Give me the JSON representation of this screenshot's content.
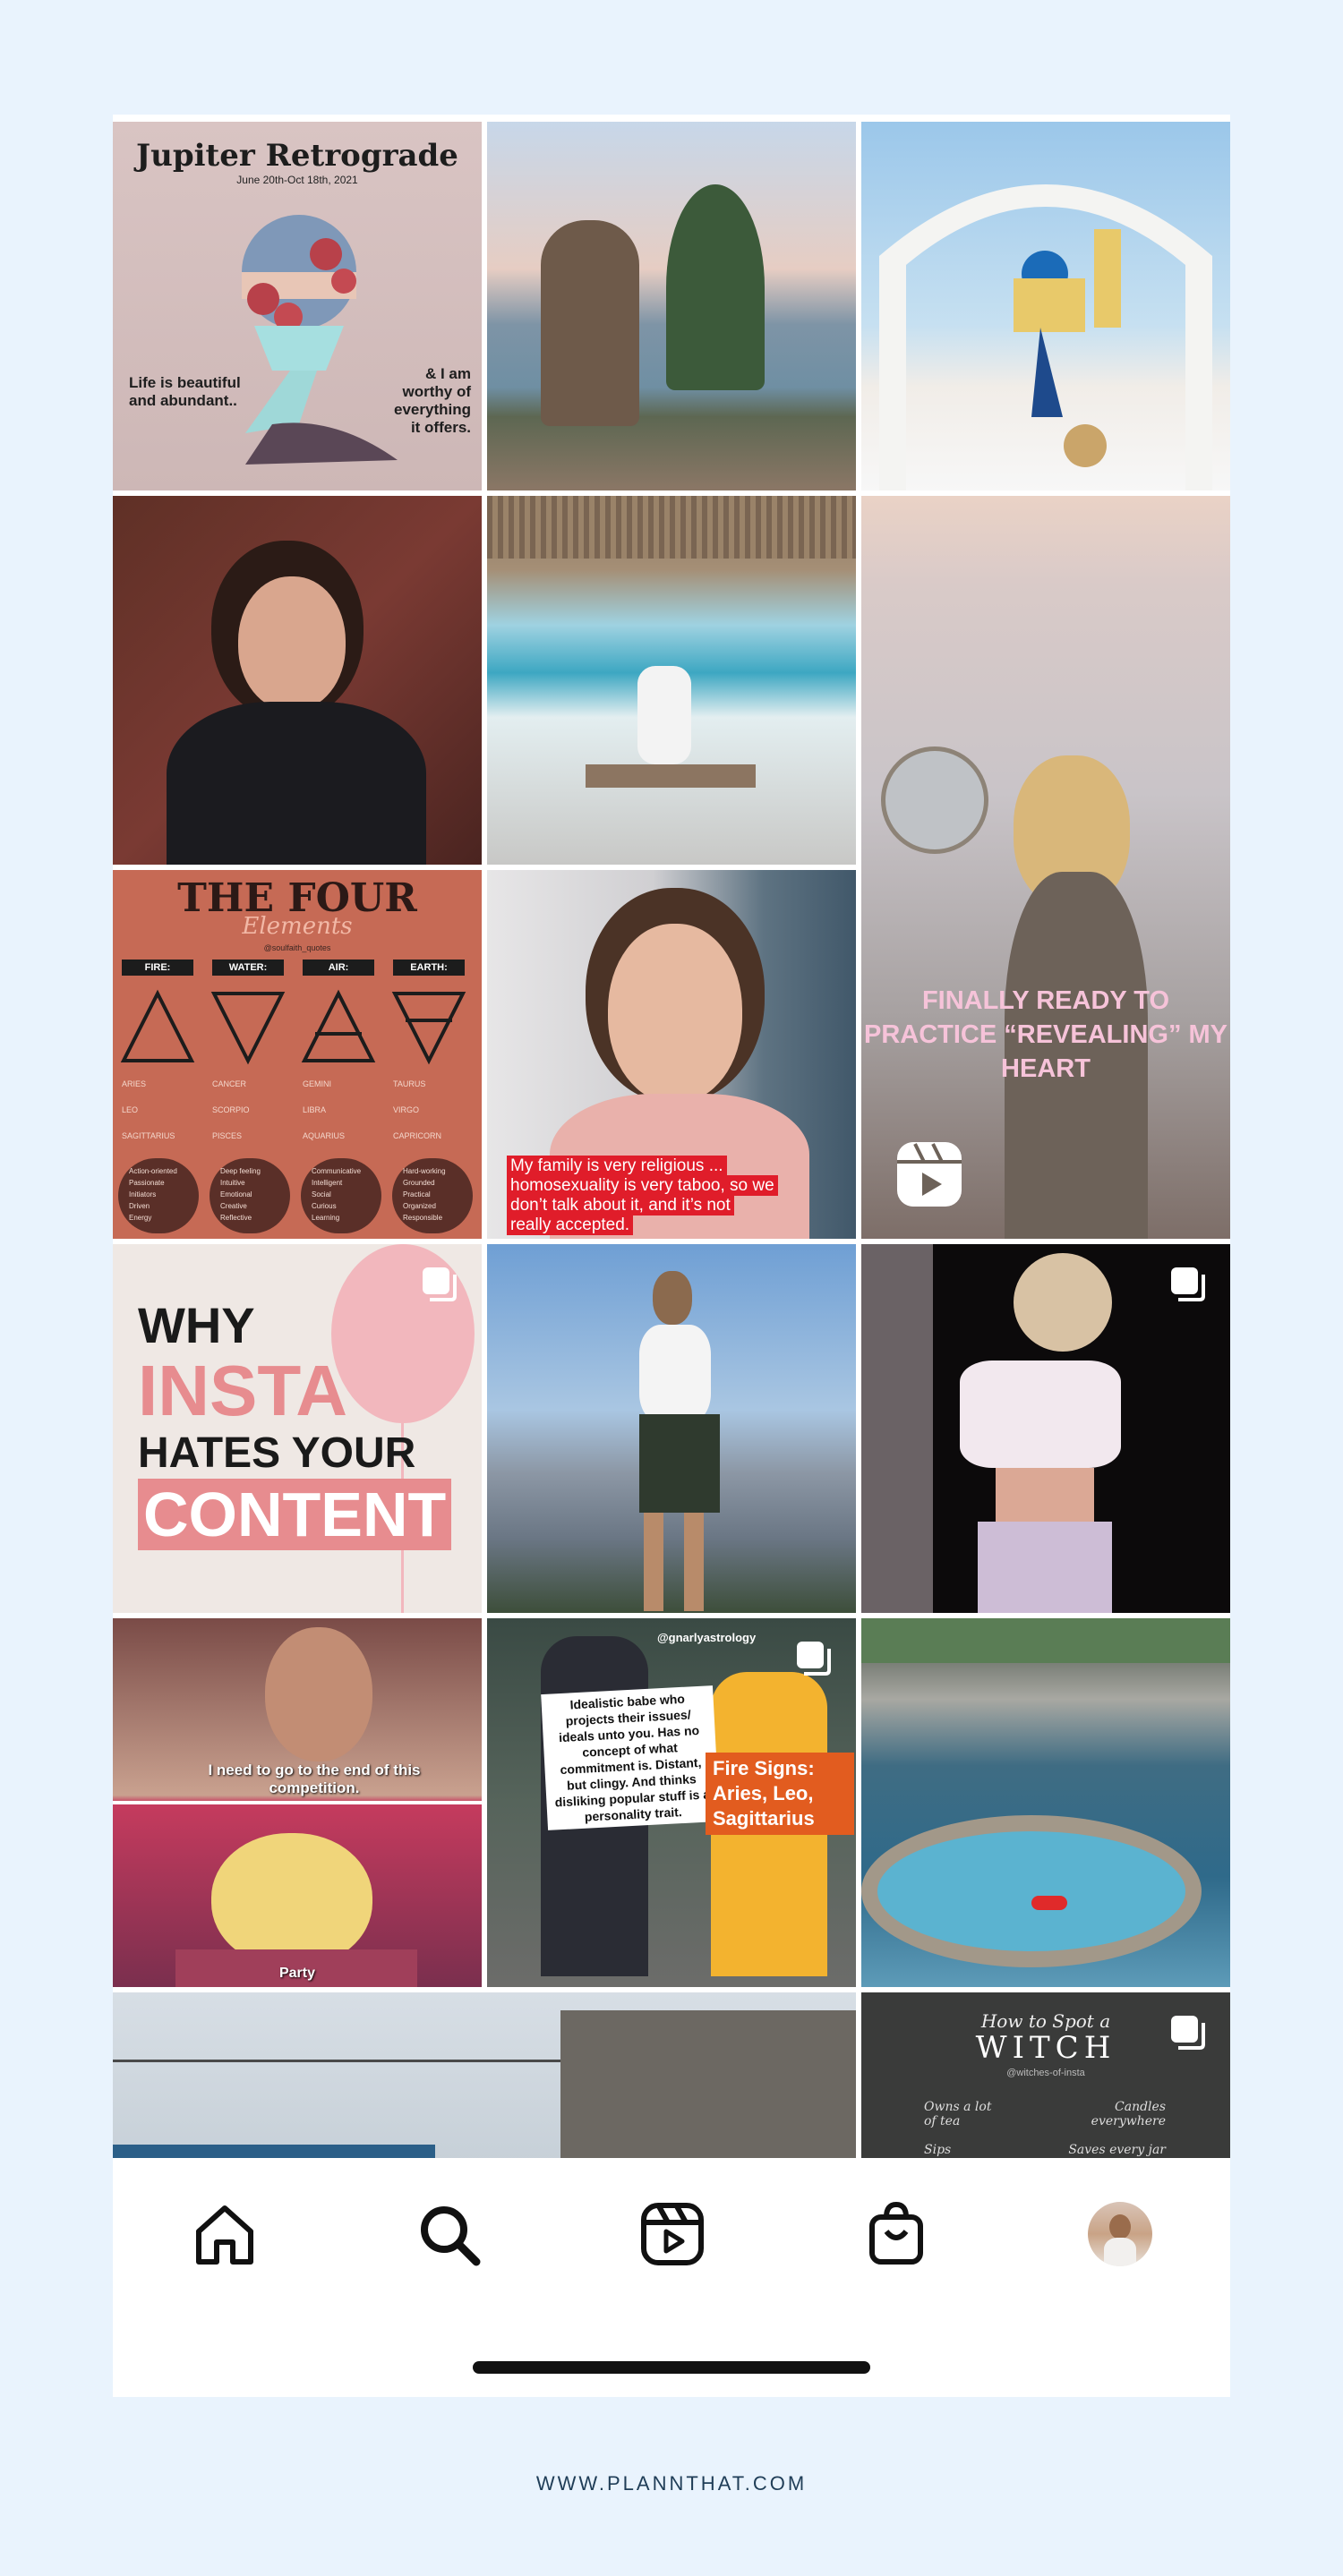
{
  "posts": [
    {
      "id": "jupiter",
      "title": "Jupiter Retrograde",
      "dates": "June 20th-Oct 18th, 2021",
      "left_text": "Life is beautiful and abundant..",
      "right_text": "& I am worthy of everything it offers.",
      "multi": false
    },
    {
      "id": "lake",
      "multi": false
    },
    {
      "id": "santorini",
      "multi": false
    },
    {
      "id": "selfie",
      "multi": false
    },
    {
      "id": "swing",
      "multi": false
    },
    {
      "id": "reel-dance",
      "caption": "FINALLY READY TO PRACTICE “REVEALING” MY HEART",
      "reel": true
    },
    {
      "id": "four-elements",
      "title": "THE FOUR",
      "subtitle": "Elements",
      "handle": "@soulfaith_quotes",
      "elements": [
        {
          "name": "FIRE:",
          "signs": [
            "ARIES",
            "LEO",
            "SAGITTARIUS"
          ],
          "traits": [
            "Action-oriented",
            "Passionate",
            "Initiators",
            "Driven",
            "Energy"
          ]
        },
        {
          "name": "WATER:",
          "signs": [
            "CANCER",
            "SCORPIO",
            "PISCES"
          ],
          "traits": [
            "Deep feeling",
            "Intuitive",
            "Emotional",
            "Creative",
            "Reflective"
          ]
        },
        {
          "name": "AIR:",
          "signs": [
            "GEMINI",
            "LIBRA",
            "AQUARIUS"
          ],
          "traits": [
            "Communicative",
            "Intelligent",
            "Social",
            "Curious",
            "Learning"
          ]
        },
        {
          "name": "EARTH:",
          "signs": [
            "TAURUS",
            "VIRGO",
            "CAPRICORN"
          ],
          "traits": [
            "Hard-working",
            "Grounded",
            "Practical",
            "Organized",
            "Responsible"
          ]
        }
      ]
    },
    {
      "id": "portrait",
      "caption": "My family is very religious ... homosexuality is very taboo, so we don’t talk about it, and it’s not really accepted.",
      "multi": false
    },
    {
      "id": "why-insta",
      "line1": "WHY",
      "line2": "INSTA",
      "line3": "HATES YOUR",
      "line4": "CONTENT",
      "multi": true
    },
    {
      "id": "mountain",
      "multi": false
    },
    {
      "id": "night",
      "multi": true
    },
    {
      "id": "drag",
      "caption_top": "I need to go to the end of this competition.",
      "caption_bottom": "Party",
      "multi": false
    },
    {
      "id": "fire-signs",
      "handle": "@gnarlyastrology",
      "quote": "Idealistic babe who projects their issues/ ideals unto you. Has no concept of what commitment is. Distant, but clingy. And thinks disliking popular stuff is a personality trait.",
      "label": "Fire Signs: Aries, Leo, Sagittarius",
      "multi": true
    },
    {
      "id": "hot-spring",
      "multi": false
    },
    {
      "id": "street",
      "multi": false
    },
    {
      "id": "witch",
      "title_small": "How to Spot a",
      "title": "WITCH",
      "handle": "@witches-of-insta",
      "row1_left": "Owns a lot of tea",
      "row1_right": "Candles everywhere",
      "row2_left": "Sips moonwater",
      "row2_right": "Saves every jar",
      "multi": true
    }
  ],
  "tabbar": [
    {
      "id": "home",
      "icon": "home-icon"
    },
    {
      "id": "search",
      "icon": "search-icon"
    },
    {
      "id": "reels",
      "icon": "reels-icon"
    },
    {
      "id": "shop",
      "icon": "shop-bag-icon"
    },
    {
      "id": "profile",
      "icon": "profile-avatar"
    }
  ],
  "footer": "WWW.PLANNTHAT.COM"
}
